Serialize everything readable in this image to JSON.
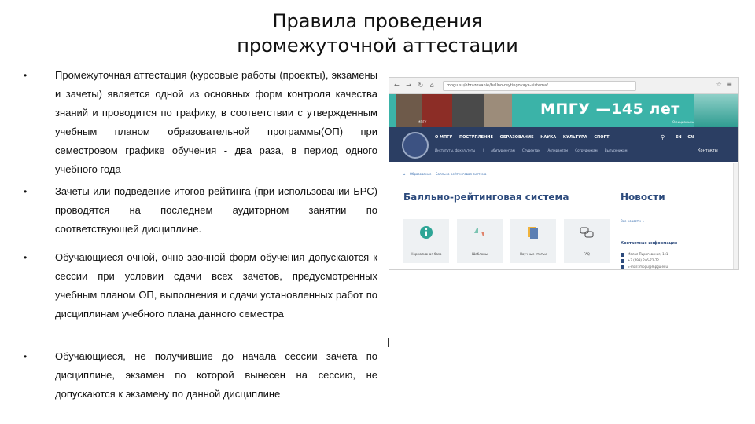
{
  "title": {
    "line1": "Правила проведения",
    "line2": "промежуточной аттестации"
  },
  "bullets": [
    {
      "symbol": "•",
      "text": "Промежуточная аттестация (курсовые работы (проекты), экзамены и зачеты) является одной из основных форм контроля качества знаний и проводится по графику, в соответствии с утвержденным учебным планом образовательной программы(ОП) при семестровом графике обучения - два раза, в период одного учебного года"
    },
    {
      "symbol": "•",
      "text": "Зачеты или подведение итогов рейтинга (при использовании БРС) проводятся на последнем аудиторном занятии по соответствующей дисциплине."
    },
    {
      "symbol": "•",
      "text": "Обучающиеся очной, очно-заочной форм обучения допускаются к сессии при условии сдачи всех зачетов, предусмотренных учебным планом ОП, выполнения и сдачи установленных работ по дисциплинам учебного плана данного семестра"
    },
    {
      "symbol": "•",
      "text": "Обучающиеся, не получившие до начала сессии зачета по дисциплине, экзамен по которой вынесен на сессию, не допускаются к экзамену по данной дисциплине"
    }
  ],
  "screenshot": {
    "browser": {
      "nav": "← → ↻ ⌂",
      "url": "mpgu.su/obrazovanie/ballno-reytingovaya-sistema/",
      "tools": "☆ ≡"
    },
    "banner": {
      "headline": "МПГУ —145 лет",
      "caption_left": "МПГУ",
      "caption_right": "Официальный портал МПГУ",
      "accent_color": "#3bb3a8"
    },
    "nav": {
      "menu": [
        "О МПГУ",
        "ПОСТУПЛЕНИЕ",
        "ОБРАЗОВАНИЕ",
        "НАУКА",
        "КУЛЬТУРА",
        "СПОРТ"
      ],
      "submenu": [
        "Институты, факультеты",
        "|",
        "Абитуриентам",
        "Студентам",
        "Аспирантам",
        "Сотрудникам",
        "Выпускникам"
      ],
      "search_icon": "search-icon",
      "langs": [
        "EN",
        "CN"
      ],
      "contacts_label": "Контакты",
      "bg_color": "#2b3e63"
    },
    "breadcrumbs": [
      "⌂",
      "Образование",
      "Балльно-рейтинговая система"
    ],
    "section_title": "Балльно-рейтинговая система",
    "tiles": [
      {
        "label": "Нормативная база",
        "icon": "info-icon"
      },
      {
        "label": "Шаблоны",
        "icon": "thumbs-icon"
      },
      {
        "label": "Научные статьи",
        "icon": "document-icon"
      },
      {
        "label": "FAQ",
        "icon": "speech-bubbles-icon"
      }
    ],
    "news_title": "Новости",
    "news_link": "Все новости →",
    "contact_title": "Контактная информация",
    "contact_rows": [
      "Малая Пироговская, 1с1",
      "+7 (499) 246-72-72",
      "E-mail: mpgu@mpgu.edu"
    ]
  }
}
